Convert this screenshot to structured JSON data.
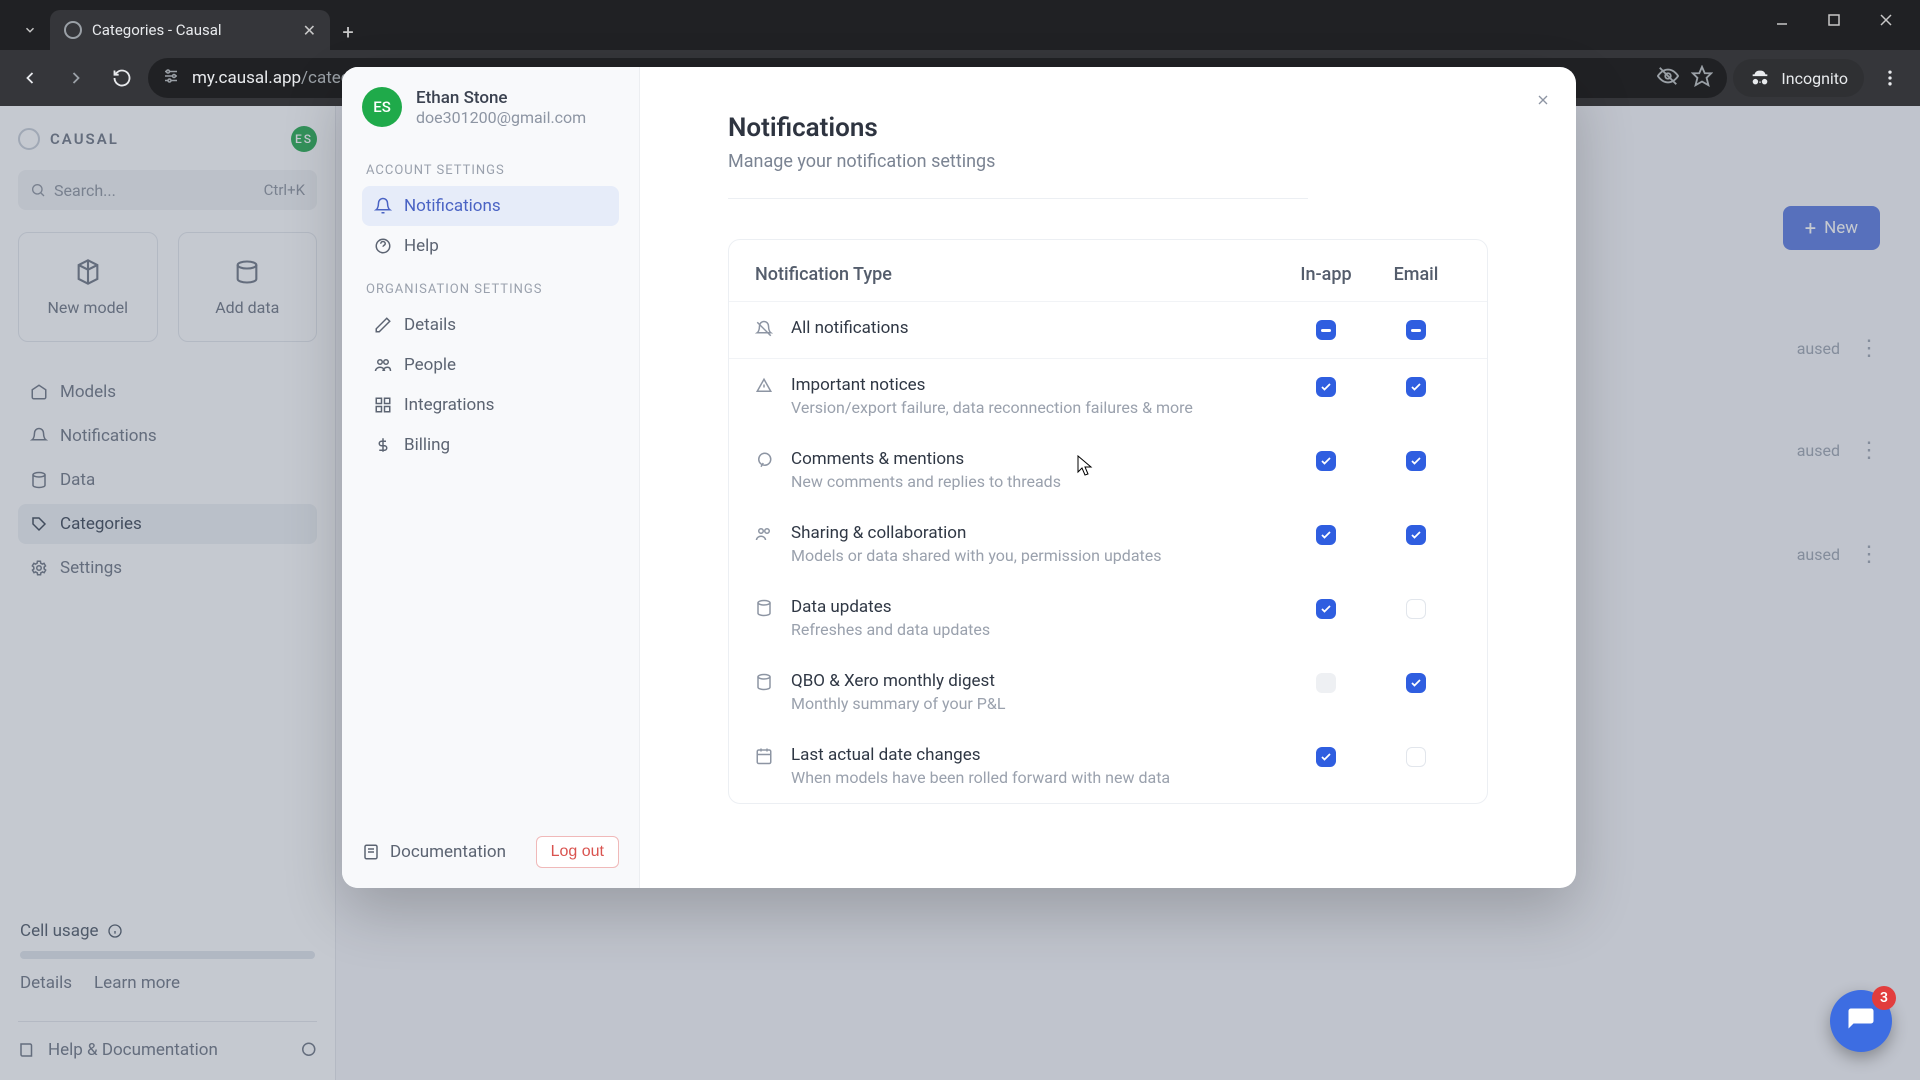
{
  "browser": {
    "tab_title": "Categories - Causal",
    "url_domain": "my.causal.app",
    "url_path": "/categories",
    "incognito_label": "Incognito"
  },
  "app": {
    "brand": "CAUSAL",
    "avatar_initials": "ES",
    "search_placeholder": "Search...",
    "search_shortcut": "Ctrl+K",
    "tiles": {
      "new_model": "New model",
      "add_data": "Add data"
    },
    "nav": {
      "models": "Models",
      "notifications": "Notifications",
      "data": "Data",
      "categories": "Categories",
      "settings": "Settings"
    },
    "new_button": "New",
    "paused_badge": "aused",
    "cell_usage": {
      "title": "Cell usage",
      "details": "Details",
      "learn": "Learn more"
    },
    "help_doc": "Help & Documentation"
  },
  "modal": {
    "profile": {
      "initials": "ES",
      "name": "Ethan Stone",
      "email": "doe301200@gmail.com"
    },
    "sections": {
      "account_label": "ACCOUNT SETTINGS",
      "org_label": "ORGANISATION SETTINGS"
    },
    "sidebar": {
      "notifications": "Notifications",
      "help": "Help",
      "details": "Details",
      "people": "People",
      "integrations": "Integrations",
      "billing": "Billing",
      "documentation": "Documentation",
      "logout": "Log out"
    },
    "title": "Notifications",
    "subtitle": "Manage your notification settings",
    "table": {
      "type_header": "Notification Type",
      "col_inapp": "In-app",
      "col_email": "Email",
      "rows": [
        {
          "title": "All notifications",
          "desc": "",
          "inapp": "mixed",
          "email": "mixed"
        },
        {
          "title": "Important notices",
          "desc": "Version/export failure, data reconnection failures & more",
          "inapp": "checked",
          "email": "checked"
        },
        {
          "title": "Comments & mentions",
          "desc": "New comments and replies to threads",
          "inapp": "checked",
          "email": "checked"
        },
        {
          "title": "Sharing & collaboration",
          "desc": "Models or data shared with you, permission updates",
          "inapp": "checked",
          "email": "checked"
        },
        {
          "title": "Data updates",
          "desc": "Refreshes and data updates",
          "inapp": "checked",
          "email": "unchecked"
        },
        {
          "title": "QBO & Xero monthly digest",
          "desc": "Monthly summary of your P&L",
          "inapp": "disabled",
          "email": "checked"
        },
        {
          "title": "Last actual date changes",
          "desc": "When models have been rolled forward with new data",
          "inapp": "checked",
          "email": "unchecked"
        }
      ]
    }
  },
  "chat": {
    "badge": "3"
  }
}
